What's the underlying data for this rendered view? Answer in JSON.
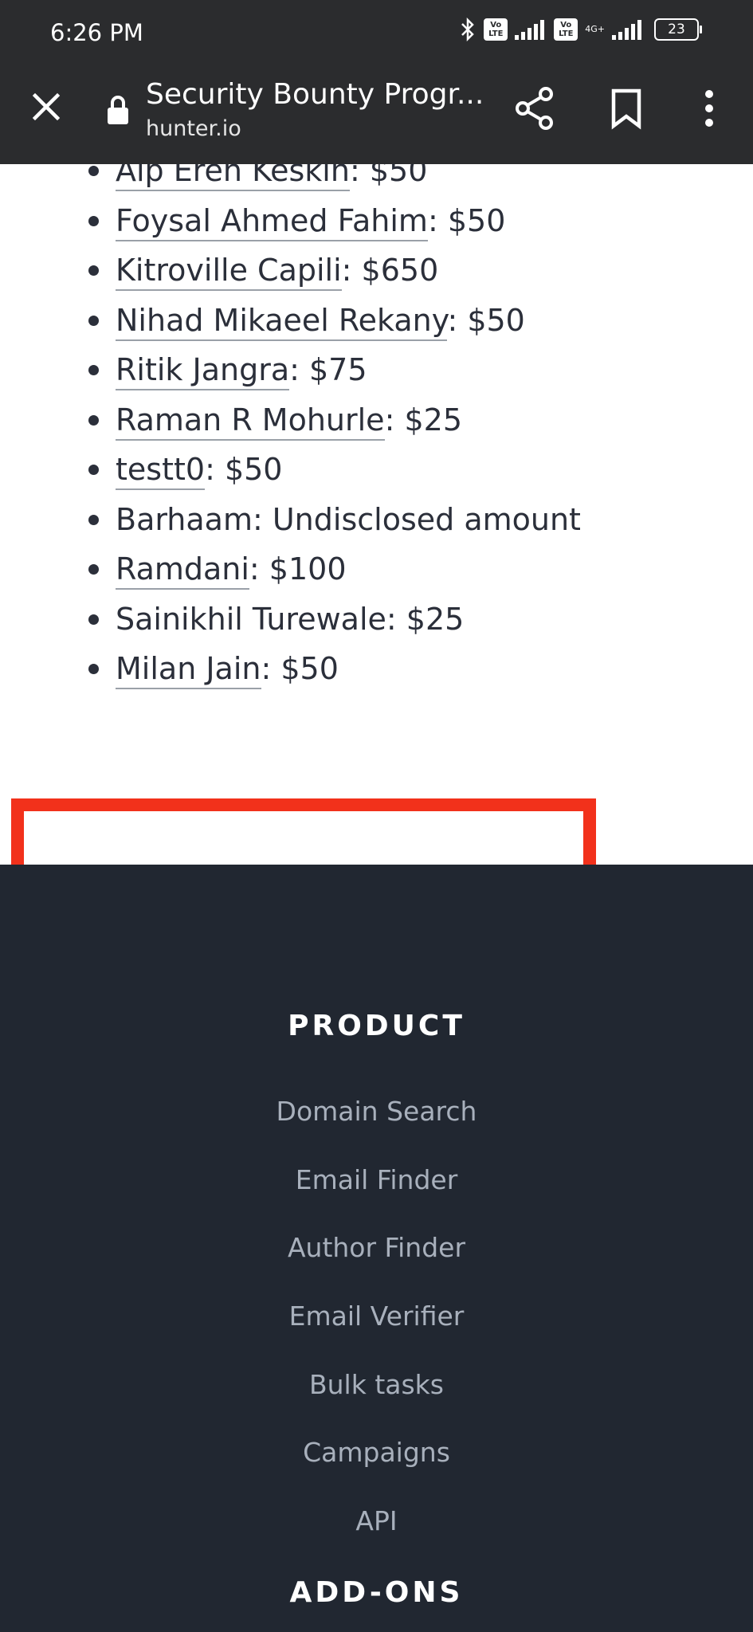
{
  "status_bar": {
    "time": "6:26 PM",
    "network": "4G+",
    "battery": "23",
    "volte": "Vo LTE"
  },
  "toolbar": {
    "title": "Security Bounty Progr...",
    "domain": "hunter.io"
  },
  "bounties": [
    {
      "name": "Alp Eren Keskin",
      "amount": ": $50",
      "linked": true
    },
    {
      "name": "Foysal Ahmed Fahim",
      "amount": ": $50",
      "linked": true
    },
    {
      "name": "Kitroville Capili",
      "amount": ": $650",
      "linked": true
    },
    {
      "name": "Nihad Mikaeel Rekany",
      "amount": ": $50",
      "linked": true
    },
    {
      "name": "Ritik Jangra",
      "amount": ": $75",
      "linked": true
    },
    {
      "name": "Raman R Mohurle",
      "amount": ": $25",
      "linked": true
    },
    {
      "name": "testt0",
      "amount": ": $50",
      "linked": true
    },
    {
      "name": "Barhaam",
      "amount": ": Undisclosed amount",
      "linked": false
    },
    {
      "name": "Ramdani",
      "amount": ": $100",
      "linked": true
    },
    {
      "name": "Sainikhil Turewale",
      "amount": ": $25",
      "linked": false
    },
    {
      "name": "Milan Jain",
      "amount": ": $50",
      "linked": true
    }
  ],
  "footer": {
    "product_heading": "PRODUCT",
    "product_links": [
      "Domain Search",
      "Email Finder",
      "Author Finder",
      "Email Verifier",
      "Bulk tasks",
      "Campaigns",
      "API"
    ],
    "addons_heading": "ADD-ONS"
  },
  "colors": {
    "highlight": "#f2311b",
    "footer_bg": "#212731",
    "toolbar_bg": "#2b2c2e"
  }
}
